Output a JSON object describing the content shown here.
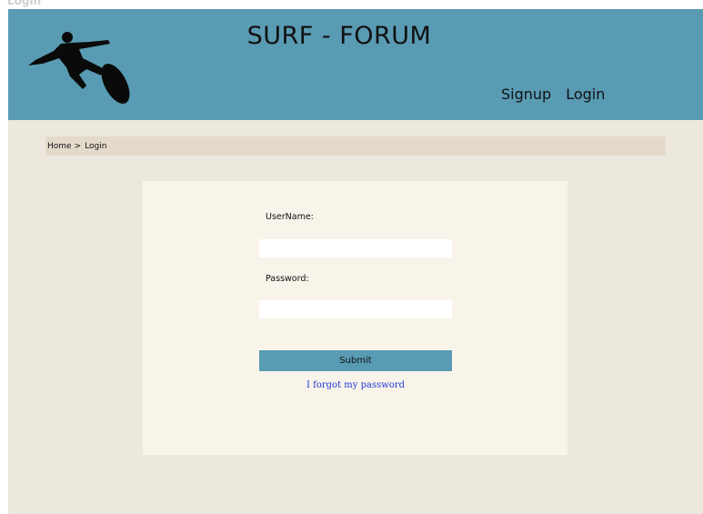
{
  "window": {
    "title": "Login"
  },
  "header": {
    "site_title": "SURF - FORUM",
    "logo_icon": "surfer-silhouette-icon",
    "nav": [
      {
        "label": "Signup"
      },
      {
        "label": "Login"
      }
    ]
  },
  "breadcrumb": {
    "home": "Home",
    "separator": ">",
    "current": "Login"
  },
  "form": {
    "username_label": "UserName:",
    "username_value": "",
    "password_label": "Password:",
    "password_value": "",
    "submit_label": "Submit",
    "forgot_link": "I forgot my password"
  },
  "colors": {
    "header_bg": "#599bb3",
    "page_bg": "#ece8de",
    "breadcrumb_bg": "#e3dacb",
    "panel_bg": "#f8f4ea",
    "button_bg": "#599bb3",
    "link": "#2336d9"
  }
}
